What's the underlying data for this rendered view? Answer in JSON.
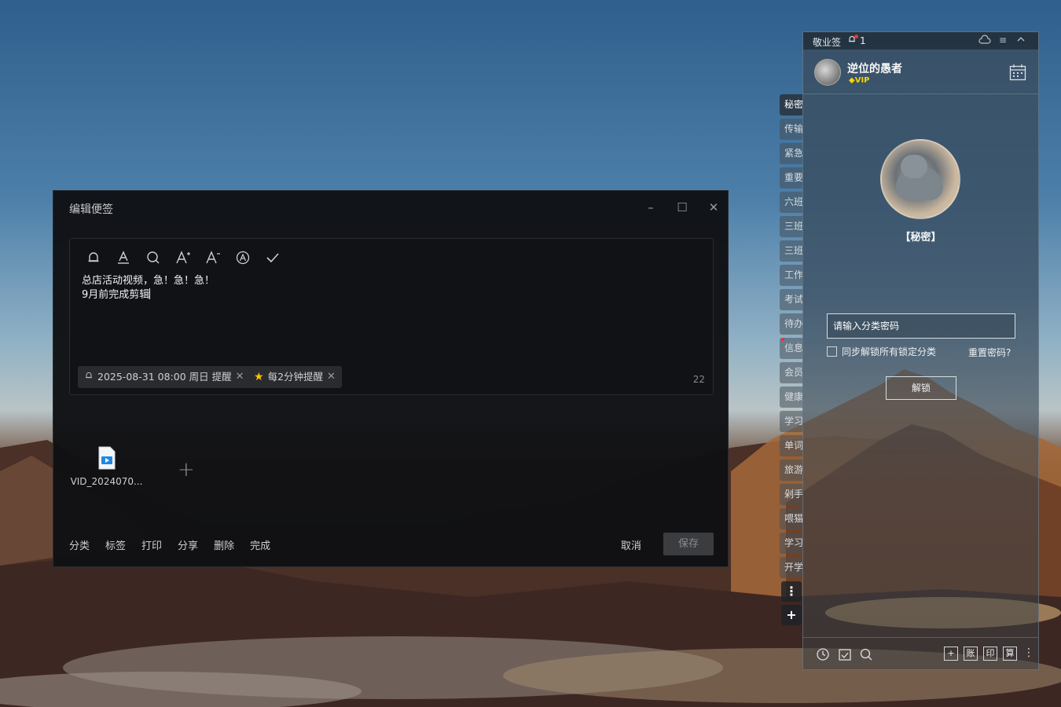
{
  "editor": {
    "title": "编辑便签",
    "toolbar": {
      "icons": [
        "bell-icon",
        "text-color-icon",
        "search-icon",
        "font-increase-icon",
        "font-decrease-icon",
        "auto-format-icon",
        "check-icon"
      ]
    },
    "note_lines": [
      "总店活动视频，急！急！急！",
      "9月前完成剪辑"
    ],
    "reminder_chip": "2025-08-31 08:00 周日 提醒",
    "repeat_chip": "每2分钟提醒",
    "char_count": "22",
    "attachment_name": "VID_2024070...",
    "bottom_actions": [
      "分类",
      "标签",
      "打印",
      "分享",
      "删除",
      "完成"
    ],
    "cancel_label": "取消",
    "save_label": "保存"
  },
  "tabs": [
    "秘密",
    "传输",
    "紧急",
    "重要",
    "六班",
    "三班",
    "三班",
    "工作",
    "考试",
    "待办",
    "信息",
    "会员",
    "健康",
    "学习",
    "单词",
    "旅游",
    "剁手",
    "喂猫",
    "学习",
    "开学"
  ],
  "panel": {
    "app_name": "敬业签",
    "notification_count": "1",
    "user_name": "逆位的愚者",
    "vip_label": "VIP",
    "category_label": "【秘密】",
    "password_placeholder": "请输入分类密码",
    "sync_label": "同步解锁所有锁定分类",
    "reset_label": "重置密码?",
    "unlock_label": "解锁",
    "box_icons": [
      "+",
      "账",
      "印",
      "算"
    ]
  },
  "colors": {
    "editor_bg": "#101114",
    "save_btn_bg": "#3a3c40",
    "vip": "#f7d400",
    "accent_red": "#e33333"
  }
}
